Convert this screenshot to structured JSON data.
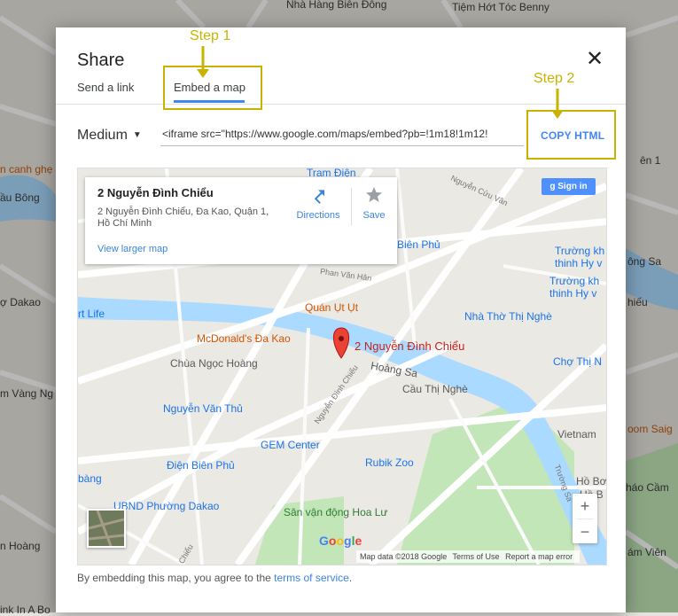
{
  "background_map": {
    "labels": [
      {
        "text": "Nhà Hàng Biên Đông",
        "style": ""
      },
      {
        "text": "Tiệm Hớt Tóc Benny",
        "style": ""
      },
      {
        "text": "n canh ghẹ",
        "style": "orange"
      },
      {
        "text": "ầu Bông",
        "style": ""
      },
      {
        "text": "ợ Dakao",
        "style": ""
      },
      {
        "text": "rt Life",
        "style": ""
      },
      {
        "text": "m Vàng Ng",
        "style": ""
      },
      {
        "text": "n Hoàng",
        "style": ""
      },
      {
        "text": "ên 1",
        "style": ""
      },
      {
        "text": "ông Sa",
        "style": ""
      },
      {
        "text": "hiếu",
        "style": ""
      },
      {
        "text": "oom Saig",
        "style": "orange"
      },
      {
        "text": "háo Cầm",
        "style": ""
      },
      {
        "text": "ám Viên",
        "style": ""
      },
      {
        "text": "ink In A Bo",
        "style": ""
      }
    ]
  },
  "dialog": {
    "title": "Share",
    "close_icon": "close-icon",
    "tabs": [
      {
        "label": "Send a link",
        "active": false
      },
      {
        "label": "Embed a map",
        "active": true
      }
    ],
    "size_select": "Medium",
    "embed_code": "<iframe src=\"https://www.google.com/maps/embed?pb=!1m18!1m12!",
    "copy_button": "COPY HTML",
    "footer_prefix": "By embedding this map, you agree to the ",
    "footer_link": "terms of service",
    "footer_suffix": "."
  },
  "embedded_map": {
    "info_card": {
      "title": "2 Nguyễn Đình Chiểu",
      "address": "2 Nguyễn Đình Chiểu, Đa Kao, Quận 1, Hồ Chí Minh",
      "view_larger": "View larger map",
      "directions_label": "Directions",
      "save_label": "Save"
    },
    "sign_in": "Sign in",
    "pin_label": "2 Nguyễn Đình Chiểu",
    "labels": [
      {
        "text": "Tram Điện",
        "style": "poi-blue"
      },
      {
        "text": "Biên Phủ",
        "style": "poi-blue"
      },
      {
        "text": "Trường kh",
        "style": "poi-blue"
      },
      {
        "text": "thinh Hy v",
        "style": "poi-blue"
      },
      {
        "text": "Trường kh",
        "style": "poi-blue"
      },
      {
        "text": "thinh Hy v",
        "style": "poi-blue"
      },
      {
        "text": "Quán Ụt Ụt",
        "style": "poi-orange"
      },
      {
        "text": "Nhà Thờ Thị Nghè",
        "style": "poi-blue"
      },
      {
        "text": "rt Life",
        "style": "poi-blue"
      },
      {
        "text": "McDonald's Đa Kao",
        "style": "poi-orange"
      },
      {
        "text": "Chùa Ngọc Hoàng",
        "style": ""
      },
      {
        "text": "Hoàng Sa",
        "style": ""
      },
      {
        "text": "Chợ Thị N",
        "style": "poi-blue"
      },
      {
        "text": "Cầu Thị Nghè",
        "style": ""
      },
      {
        "text": "Nguyễn Văn Thủ",
        "style": "poi-blue"
      },
      {
        "text": "GEM Center",
        "style": "poi-blue"
      },
      {
        "text": "Vietnam",
        "style": ""
      },
      {
        "text": "Điện Biên Phủ",
        "style": "poi-blue"
      },
      {
        "text": "Rubik Zoo",
        "style": "poi-blue"
      },
      {
        "text": "Hồ Bơ",
        "style": ""
      },
      {
        "text": "Hồ B",
        "style": ""
      },
      {
        "text": "bàng",
        "style": "poi-blue"
      },
      {
        "text": "UBND Phường Dakao",
        "style": "poi-blue"
      },
      {
        "text": "Sân vận động Hoa Lư",
        "style": ""
      },
      {
        "text": "Phan Văn Hân",
        "style": "street"
      },
      {
        "text": "Nguyễn Cửu Vân",
        "style": "street"
      },
      {
        "text": "Nguyễn Đình Chiểu",
        "style": "street"
      },
      {
        "text": "Trường Sa",
        "style": "street"
      },
      {
        "text": "Chiểu",
        "style": "street"
      }
    ],
    "zoom_in": "+",
    "zoom_out": "−",
    "google": "Google",
    "attribution": [
      "Map data ©2018 Google",
      "Terms of Use",
      "Report a map error"
    ]
  },
  "annotations": {
    "step1": "Step 1",
    "step2": "Step 2"
  },
  "colors": {
    "accent": "#4285f4",
    "annotation": "#c8b400",
    "water": "#aadaff",
    "park": "#c3e6b8"
  }
}
